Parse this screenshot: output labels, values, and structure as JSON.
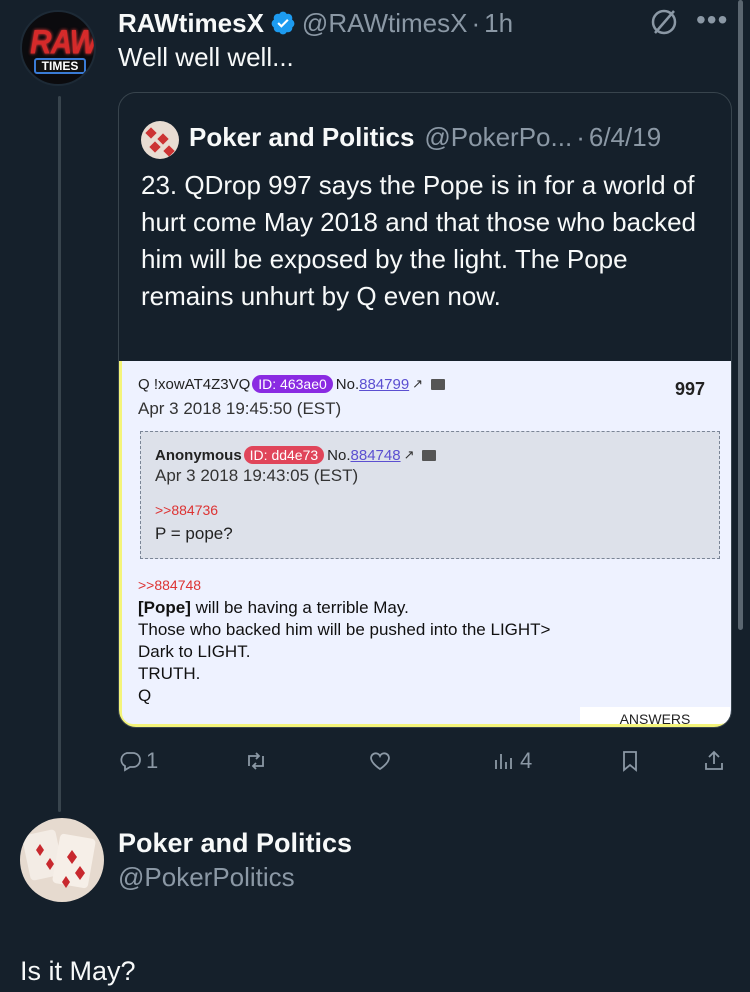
{
  "tweet": {
    "author_name": "RAWtimesX",
    "author_handle": "@RAWtimesX",
    "time": "1h",
    "text": "Well well well...",
    "avatar_text_top": "RAW",
    "avatar_text_bottom": "TIMES"
  },
  "quote": {
    "author_name": "Poker and Politics",
    "author_handle": "@PokerPo...",
    "date": "6/4/19",
    "text": "23. QDrop 997 says the Pope is in for a world of hurt come May 2018 and that those who backed him will be exposed by the light. The Pope remains unhurt by Q even now."
  },
  "board": {
    "post": {
      "author": "Q !xowAT4Z3VQ",
      "id": "ID: 463ae0",
      "id_color": "#8a2be2",
      "no_prefix": "No.",
      "no": "884799",
      "date": "Apr 3 2018 19:45:50 (EST)",
      "drop_number": "997"
    },
    "reply": {
      "author": "Anonymous",
      "id": "ID: dd4e73",
      "id_color": "#e0455a",
      "no_prefix": "No.",
      "no": "884748",
      "date": "Apr 3 2018 19:43:05 (EST)",
      "ref": ">>884736",
      "body": "P = pope?"
    },
    "main_ref": ">>884748",
    "main_bold": "[Pope]",
    "main_line1_rest": " will be having a terrible May.",
    "main_line2": "Those who backed him will be pushed into the LIGHT>",
    "main_line3": "Dark to LIGHT.",
    "main_line4": "TRUTH.",
    "main_line5": "Q",
    "answers_label": "ANSWERS"
  },
  "actions": {
    "reply_count": "1",
    "retweet_count": "",
    "like_count": "",
    "views_count": "4"
  },
  "reply_tweet": {
    "author_name": "Poker and Politics",
    "author_handle": "@PokerPolitics",
    "text": "Is it May?"
  },
  "colors": {
    "background": "#15202b",
    "text": "#f7f9f9",
    "muted": "#8b98a5",
    "verified": "#1d9bf0",
    "border": "#38444d"
  },
  "icons": {
    "reply": "reply-icon",
    "retweet": "retweet-icon",
    "like": "heart-icon",
    "views": "views-icon",
    "bookmark": "bookmark-icon",
    "share": "share-icon",
    "grok": "grok-icon",
    "more": "more-icon"
  }
}
